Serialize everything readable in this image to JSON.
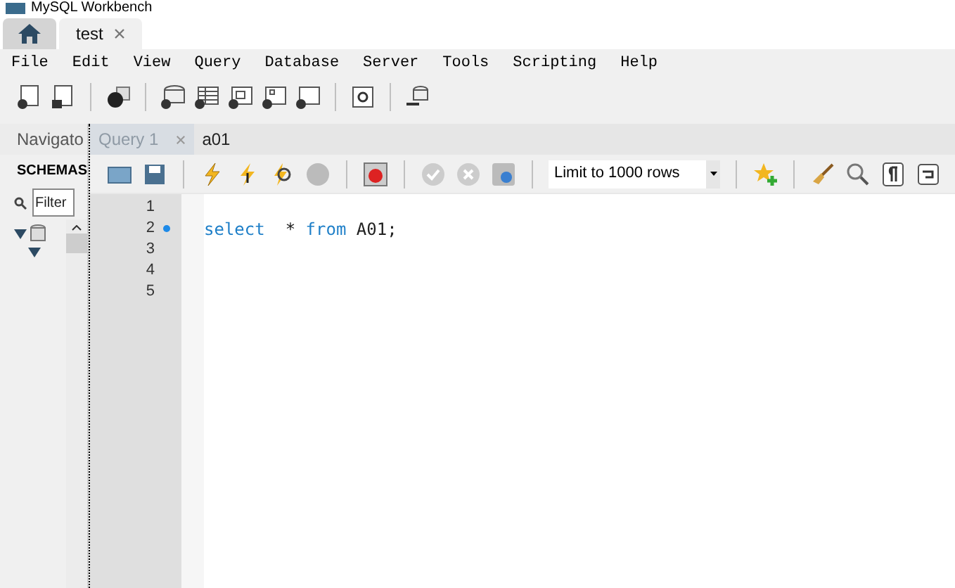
{
  "window": {
    "title": "MySQL Workbench"
  },
  "connection_tabs": [
    {
      "kind": "home",
      "selected": false
    },
    {
      "kind": "connection",
      "label": "test",
      "selected": true
    }
  ],
  "menu": [
    "File",
    "Edit",
    "View",
    "Query",
    "Database",
    "Server",
    "Tools",
    "Scripting",
    "Help"
  ],
  "navigator": {
    "title": "Navigato",
    "section": "SCHEMAS",
    "filter": {
      "placeholder": "Filter"
    },
    "tree": [
      {
        "expanded": true,
        "children": [
          {
            "expanded": true
          }
        ]
      }
    ]
  },
  "query_tabs": [
    {
      "label": "Query 1",
      "selected": true
    },
    {
      "label": "a01",
      "selected": false
    }
  ],
  "limit": {
    "value": "Limit to 1000 rows"
  },
  "editor": {
    "lines": [
      {
        "number": "1",
        "marker": false
      },
      {
        "number": "2",
        "marker": true,
        "code": "select  * from A01;"
      },
      {
        "number": "3",
        "marker": false
      },
      {
        "number": "4",
        "marker": false
      },
      {
        "number": "5",
        "marker": false
      }
    ]
  }
}
